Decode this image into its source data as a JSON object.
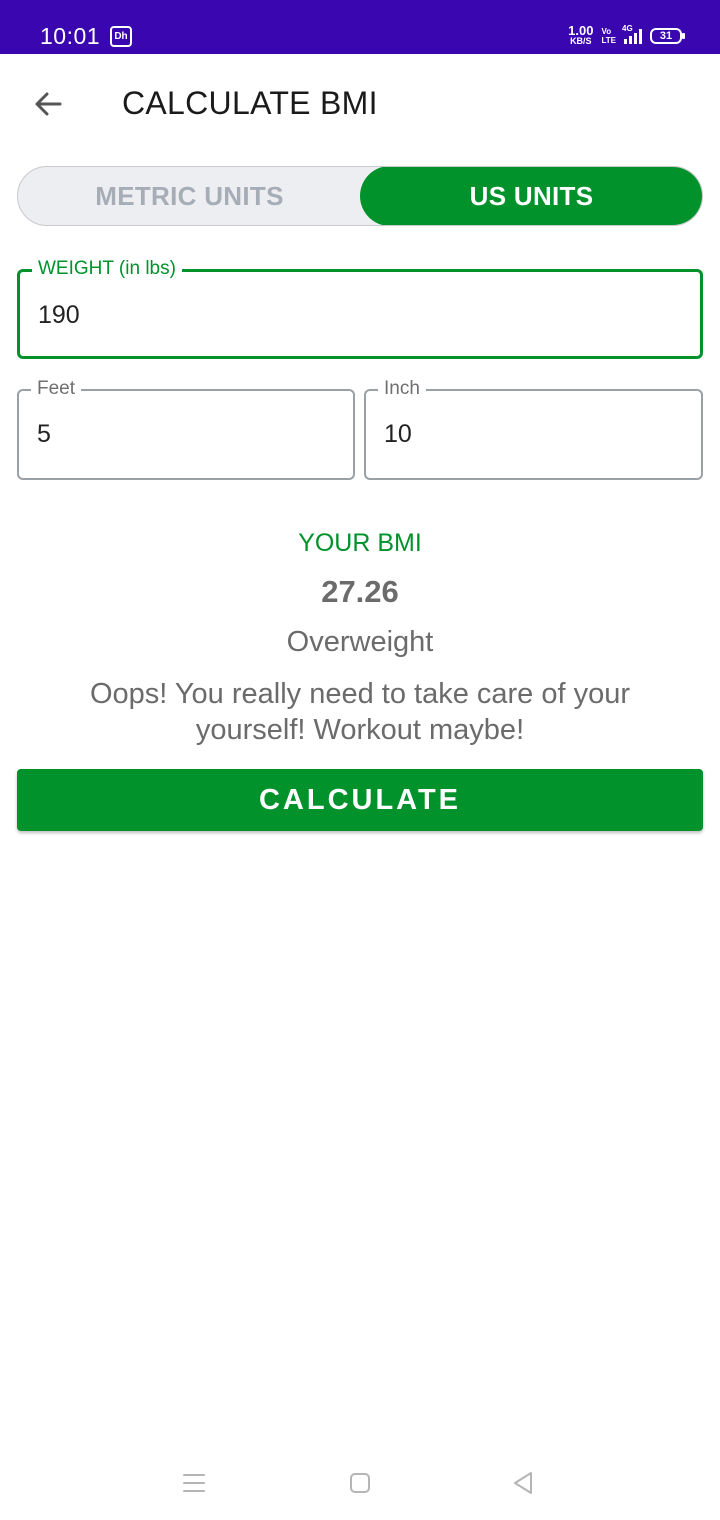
{
  "status_bar": {
    "time": "10:01",
    "app_icon_text": "Dh",
    "net_speed_value": "1.00",
    "net_speed_unit": "KB/S",
    "volte_top": "Vo",
    "volte_bottom": "LTE",
    "signal_label": "4G",
    "battery": "31",
    "background": "#3a06b0"
  },
  "toolbar": {
    "back_icon": "arrow-back-icon",
    "title": "CALCULATE BMI"
  },
  "unit_toggle": {
    "options": [
      {
        "label": "METRIC UNITS",
        "selected": false
      },
      {
        "label": "US UNITS",
        "selected": true
      }
    ],
    "accent": "#01922b"
  },
  "fields": {
    "weight": {
      "label": "WEIGHT (in lbs)",
      "value": "190",
      "focused": true
    },
    "feet": {
      "label": "Feet",
      "value": "5"
    },
    "inch": {
      "label": "Inch",
      "value": "10"
    }
  },
  "result": {
    "label": "YOUR BMI",
    "value": "27.26",
    "category": "Overweight",
    "description": "Oops! You really need to take care of your yourself! Workout maybe!"
  },
  "calculate_button": {
    "label": "CALCULATE"
  },
  "nav_bar": {
    "icons": [
      "menu-icon",
      "home-icon",
      "back-triangle-icon"
    ]
  }
}
